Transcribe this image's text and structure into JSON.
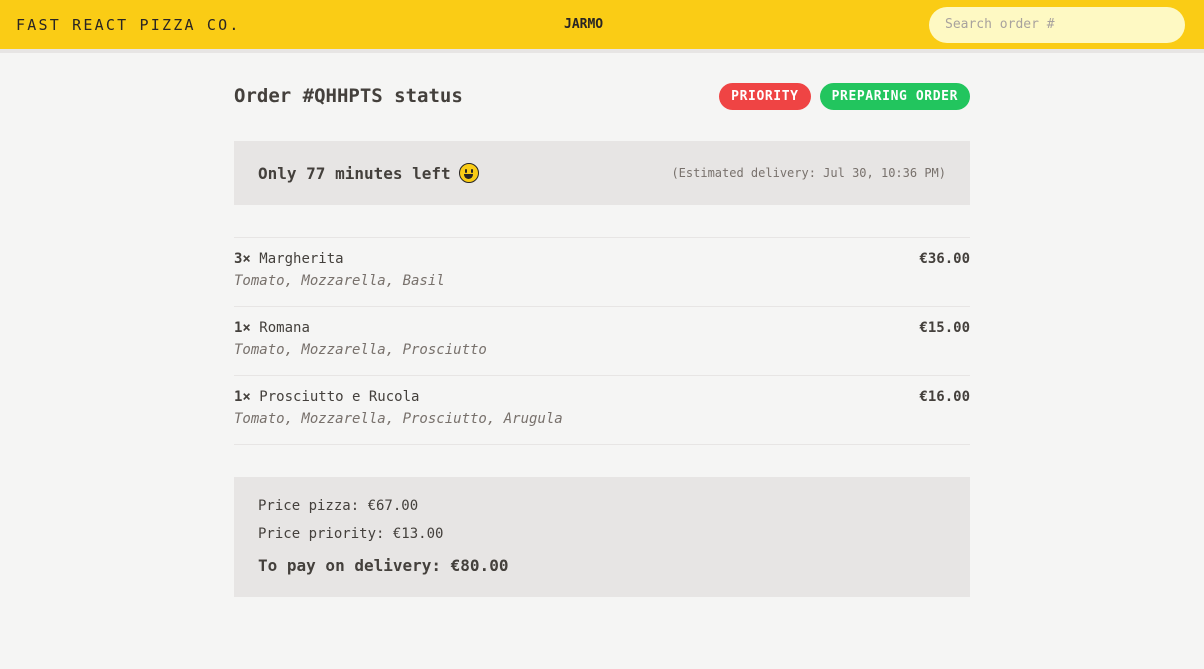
{
  "header": {
    "logo": "Fast React Pizza Co.",
    "username": "JARMO",
    "search_placeholder": "Search order #"
  },
  "order": {
    "title": "Order #QHHPTS status",
    "badges": {
      "priority": "Priority",
      "status": "Preparing order"
    },
    "eta": {
      "time_left": "Only 77 minutes left",
      "emoji": "grinning-face-icon",
      "estimated": "(Estimated delivery: Jul 30, 10:36 PM)"
    },
    "items": [
      {
        "qty": "3×",
        "name": "Margherita",
        "price": "€36.00",
        "ingredients": "Tomato, Mozzarella, Basil"
      },
      {
        "qty": "1×",
        "name": "Romana",
        "price": "€15.00",
        "ingredients": "Tomato, Mozzarella, Prosciutto"
      },
      {
        "qty": "1×",
        "name": "Prosciutto e Rucola",
        "price": "€16.00",
        "ingredients": "Tomato, Mozzarella, Prosciutto, Arugula"
      }
    ],
    "summary": {
      "price_pizza": "Price pizza: €67.00",
      "price_priority": "Price priority: €13.00",
      "total": "To pay on delivery: €80.00"
    }
  },
  "colors": {
    "header_bg": "#facc15",
    "priority_badge": "#ef4444",
    "status_badge": "#22c55e",
    "box_bg": "#e7e5e4",
    "page_bg": "#f5f5f4"
  }
}
